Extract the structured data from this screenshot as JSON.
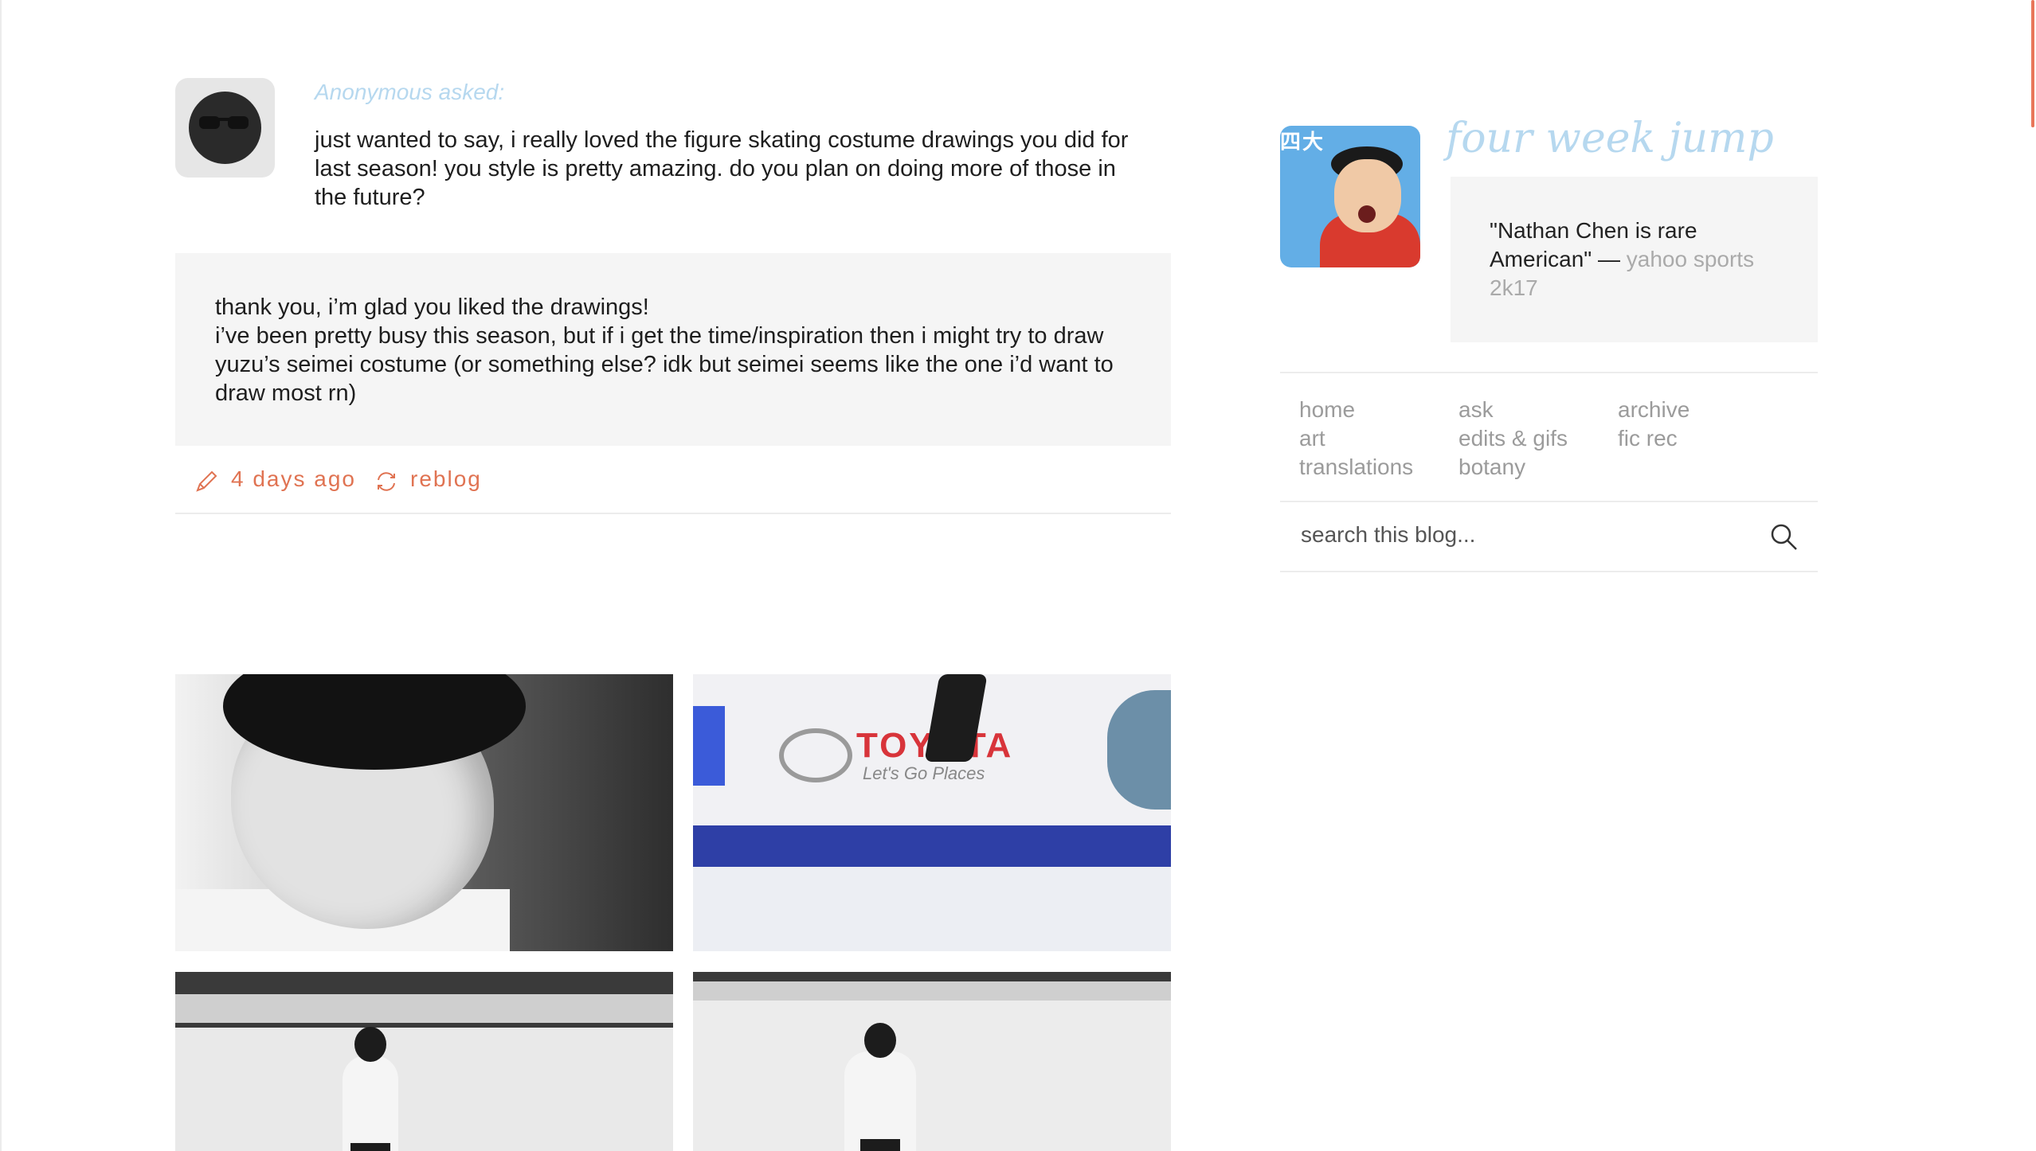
{
  "post": {
    "asker": "Anonymous asked:",
    "question": "just wanted to say, i really loved the figure skating costume drawings you did for last season! you style is pretty amazing. do you plan on doing more of those in the future?",
    "answer_lines": [
      "thank you, i’m glad you liked the drawings!",
      "i’ve been pretty busy this season, but if i get the time/inspiration then i might try to draw yuzu’s seimei costume (or something else? idk but seimei seems like the one i’d want to draw most rn)"
    ],
    "date": "4 days ago",
    "reblog_label": "reblog",
    "avatar_icon": "sunglasses-face-icon"
  },
  "photoset": {
    "sign_text": "TOYOTA",
    "sign_tagline": "Let's Go Places"
  },
  "sidebar": {
    "avatar_banner": "四大",
    "title": "four week jump",
    "description_quote": "\"Nathan Chen is rare American\"",
    "description_dash": " — ",
    "description_source": "yahoo sports 2k17",
    "nav": {
      "col1": [
        "home",
        "art",
        "translations"
      ],
      "col2": [
        "ask",
        "edits & gifs",
        "botany"
      ],
      "col3": [
        "archive",
        "fic rec"
      ]
    },
    "search_placeholder": "search this blog..."
  },
  "colors": {
    "accent": "#e07352",
    "title_blue": "#b6d8ef",
    "panel_gray": "#f5f5f5",
    "nav_gray": "#9b9b9b"
  }
}
